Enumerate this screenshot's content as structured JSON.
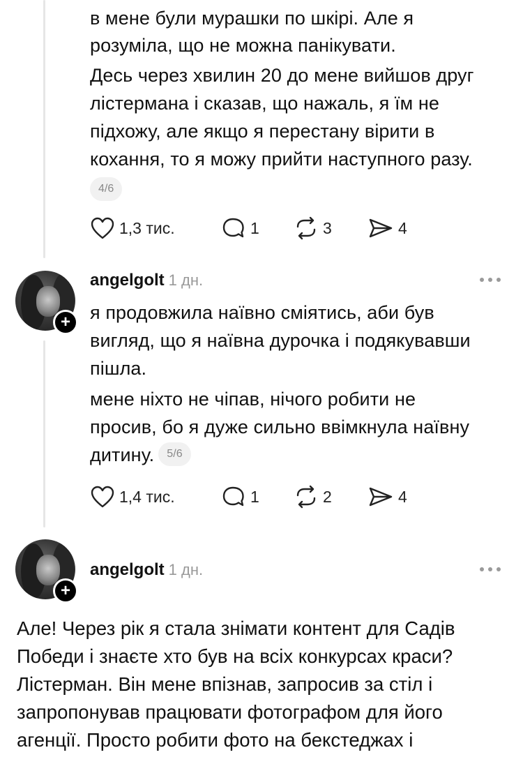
{
  "post1": {
    "paragraphs": [
      "в мене були мурашки по шкірі. Але я",
      "розуміла, що не можна панікувати.",
      "Десь через хвилин 20 до мене вийшов друг",
      "лістермана і сказав, що нажаль, я їм не",
      "підхожу, але якщо я перестану вірити в",
      "кохання, то я можу прийти наступного разу."
    ],
    "page_badge": "4/6",
    "likes": "1,3 тис.",
    "replies": "1",
    "reposts": "3",
    "shares": "4"
  },
  "post2": {
    "username": "angelgolt",
    "timestamp": "1 дн.",
    "lines": [
      "я продовжила наївно сміятись, аби був",
      "вигляд, що я наївна дурочка і подякувавши",
      "пішла.",
      "мене ніхто не чіпав, нічого робити не",
      "просив, бо я дуже сильно ввімкнула наївну",
      "дитину."
    ],
    "page_badge": "5/6",
    "likes": "1,4 тис.",
    "replies": "1",
    "reposts": "2",
    "shares": "4"
  },
  "post3": {
    "username": "angelgolt",
    "timestamp": "1 дн.",
    "lines": [
      "Але! Через рік я стала знімати контент для Садів",
      "Победи і знаєте хто був на всіх конкурсах краси?",
      "Лістерман. Він мене впізнав, запросив за стіл і",
      "запропонував працювати фотографом для його",
      "агенції. Просто робити фото на бекстеджах і"
    ]
  },
  "icons": {
    "like": "heart-icon",
    "reply": "comment-icon",
    "repost": "repost-icon",
    "share": "send-icon",
    "follow": "plus-icon",
    "more": "more-dots-icon"
  },
  "colors": {
    "text": "#111111",
    "muted": "#999999",
    "badge_bg": "#f1f1f1",
    "thread_line": "#e6e6e6"
  }
}
